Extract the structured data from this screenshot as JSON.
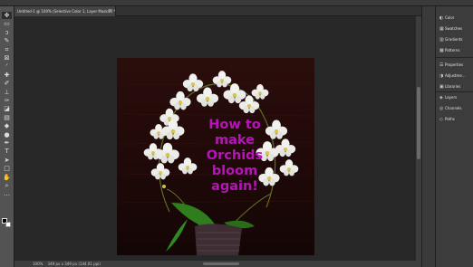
{
  "document": {
    "tab_title": "Untitled-1 @ 100% (Selective Color 1, Layer Mask/8) *",
    "close_glyph": "×"
  },
  "tools": [
    {
      "name": "move-tool-icon",
      "glyph": "✥"
    },
    {
      "name": "artboard-tool-icon",
      "glyph": "▭"
    },
    {
      "name": "lasso-tool-icon",
      "glyph": "ↄ"
    },
    {
      "name": "quick-select-tool-icon",
      "glyph": "✎"
    },
    {
      "name": "crop-tool-icon",
      "glyph": "⌗"
    },
    {
      "name": "frame-tool-icon",
      "glyph": "⊠"
    },
    {
      "name": "eyedropper-tool-icon",
      "glyph": "ᐟ"
    },
    {
      "name": "healing-brush-tool-icon",
      "glyph": "✚"
    },
    {
      "name": "brush-tool-icon",
      "glyph": "✐"
    },
    {
      "name": "clone-stamp-tool-icon",
      "glyph": "⊥"
    },
    {
      "name": "history-brush-tool-icon",
      "glyph": "✑"
    },
    {
      "name": "eraser-tool-icon",
      "glyph": "◪"
    },
    {
      "name": "gradient-tool-icon",
      "glyph": "▤"
    },
    {
      "name": "blur-tool-icon",
      "glyph": "◆"
    },
    {
      "name": "dodge-tool-icon",
      "glyph": "●"
    },
    {
      "name": "pen-tool-icon",
      "glyph": "✒"
    },
    {
      "name": "type-tool-icon",
      "glyph": "T"
    },
    {
      "name": "path-select-tool-icon",
      "glyph": "➤"
    },
    {
      "name": "rectangle-tool-icon",
      "glyph": "□"
    },
    {
      "name": "hand-tool-icon",
      "glyph": "✋"
    },
    {
      "name": "zoom-tool-icon",
      "glyph": "⌕"
    },
    {
      "name": "edit-toolbar-icon",
      "glyph": "…"
    }
  ],
  "panels": [
    {
      "name": "color-panel",
      "icon": "◐",
      "label": "Color"
    },
    {
      "name": "swatches-panel",
      "icon": "▦",
      "label": "Swatches"
    },
    {
      "name": "gradients-panel",
      "icon": "▥",
      "label": "Gradients"
    },
    {
      "name": "patterns-panel",
      "icon": "▩",
      "label": "Patterns"
    },
    {
      "name": "properties-panel",
      "icon": "☰",
      "label": "Properties"
    },
    {
      "name": "adjustments-panel",
      "icon": "◑",
      "label": "Adjustme..."
    },
    {
      "name": "libraries-panel",
      "icon": "▣",
      "label": "Libraries"
    },
    {
      "name": "layers-panel",
      "icon": "◈",
      "label": "Layers"
    },
    {
      "name": "channels-panel",
      "icon": "◎",
      "label": "Channels"
    },
    {
      "name": "paths-panel",
      "icon": "◇",
      "label": "Paths"
    }
  ],
  "canvas": {
    "headline": [
      "How to",
      "make",
      "Orchids",
      "bloom",
      "again!"
    ],
    "headline_color": "#b515b8",
    "background_color": "#1e0a09"
  },
  "status": {
    "zoom": "100%",
    "doc_info": "349 px x 349 px (144.01 ppi)"
  }
}
